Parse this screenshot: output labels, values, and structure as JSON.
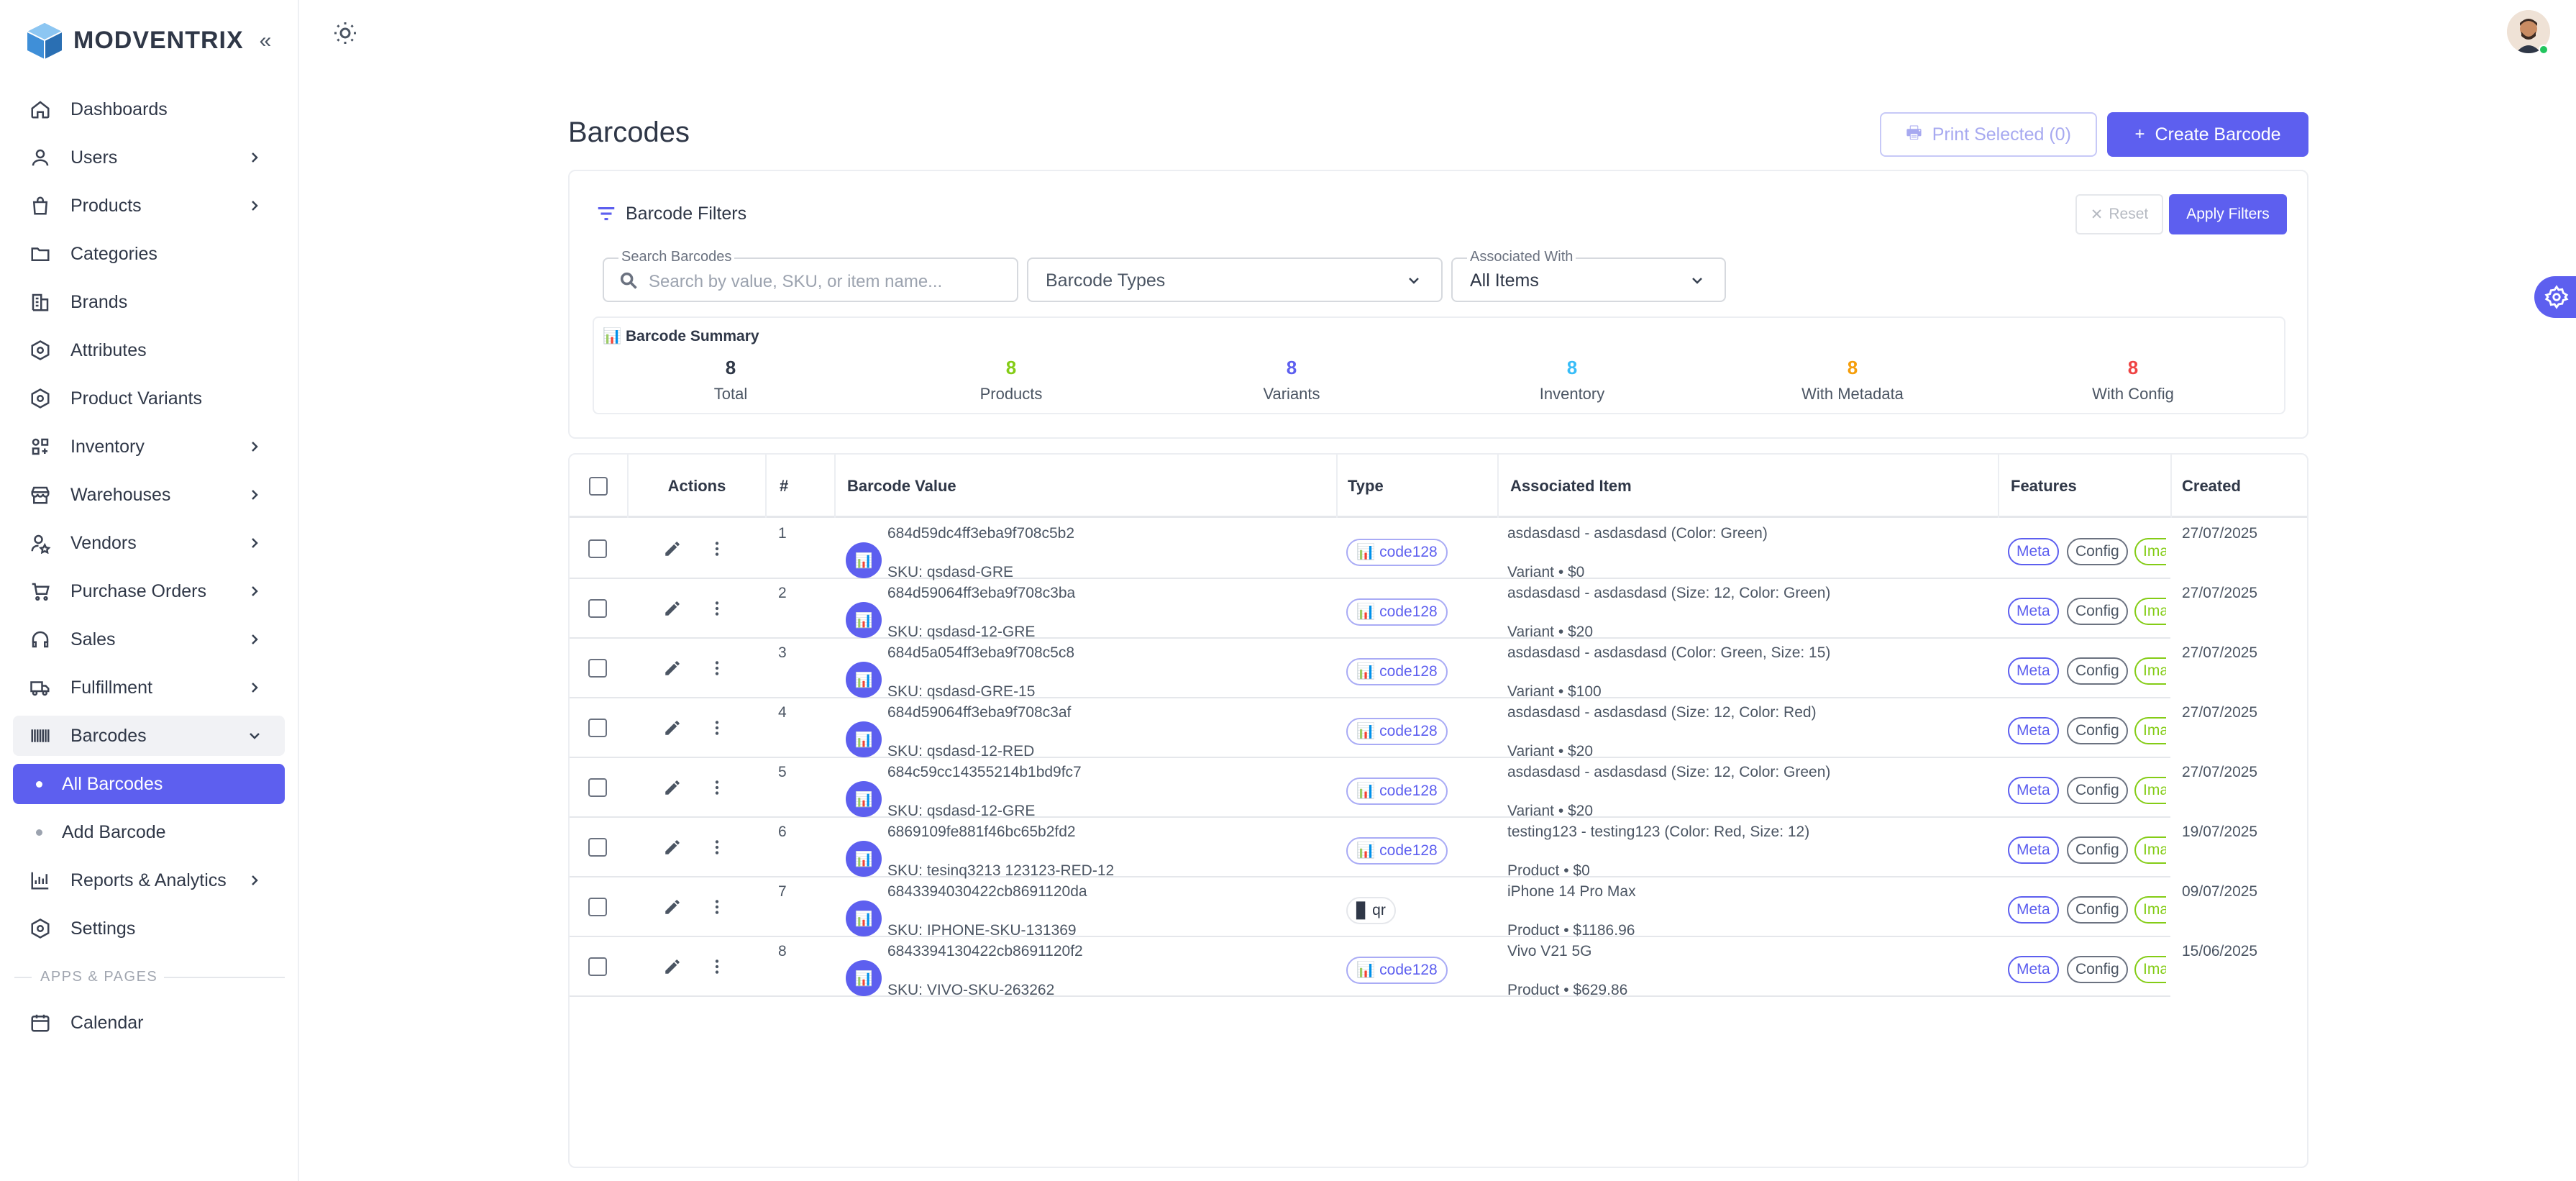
{
  "brand": {
    "name": "MODVENTRIX"
  },
  "sidebar": {
    "items": [
      {
        "label": "Dashboards",
        "icon": "home-icon",
        "chevron": false
      },
      {
        "label": "Users",
        "icon": "user-icon",
        "chevron": true
      },
      {
        "label": "Products",
        "icon": "bag-icon",
        "chevron": true
      },
      {
        "label": "Categories",
        "icon": "folder-icon",
        "chevron": false
      },
      {
        "label": "Brands",
        "icon": "building-icon",
        "chevron": false
      },
      {
        "label": "Attributes",
        "icon": "hexagon-icon",
        "chevron": false
      },
      {
        "label": "Product Variants",
        "icon": "hexagon-icon",
        "chevron": false
      },
      {
        "label": "Inventory",
        "icon": "inventory-icon",
        "chevron": true
      },
      {
        "label": "Warehouses",
        "icon": "store-icon",
        "chevron": true
      },
      {
        "label": "Vendors",
        "icon": "vendor-icon",
        "chevron": true
      },
      {
        "label": "Purchase Orders",
        "icon": "cart-icon",
        "chevron": true
      },
      {
        "label": "Sales",
        "icon": "headset-icon",
        "chevron": true
      },
      {
        "label": "Fulfillment",
        "icon": "truck-icon",
        "chevron": true
      },
      {
        "label": "Barcodes",
        "icon": "barcode-icon",
        "chevron": true
      }
    ],
    "sub_items": [
      {
        "label": "All Barcodes"
      },
      {
        "label": "Add Barcode"
      }
    ],
    "after_items": [
      {
        "label": "Reports & Analytics",
        "icon": "chart-icon",
        "chevron": true
      },
      {
        "label": "Settings",
        "icon": "hexagon-icon",
        "chevron": false
      }
    ],
    "section_label": "APPS & PAGES",
    "apps": [
      {
        "label": "Calendar",
        "icon": "calendar-icon"
      }
    ]
  },
  "page": {
    "title": "Barcodes",
    "print_label": "Print Selected (0)",
    "create_label": "Create Barcode"
  },
  "filters": {
    "title": "Barcode Filters",
    "reset_label": "Reset",
    "apply_label": "Apply Filters",
    "search_label": "Search Barcodes",
    "search_placeholder": "Search by value, SKU, or item name...",
    "types_placeholder": "Barcode Types",
    "assoc_label": "Associated With",
    "assoc_value": "All Items"
  },
  "summary": {
    "title": "📊 Barcode Summary",
    "stats": [
      {
        "value": "8",
        "label": "Total",
        "color": "#2f3747"
      },
      {
        "value": "8",
        "label": "Products",
        "color": "#84cc16"
      },
      {
        "value": "8",
        "label": "Variants",
        "color": "#5d5fef"
      },
      {
        "value": "8",
        "label": "Inventory",
        "color": "#38bdf8"
      },
      {
        "value": "8",
        "label": "With Metadata",
        "color": "#f59e0b"
      },
      {
        "value": "8",
        "label": "With Config",
        "color": "#ef4444"
      }
    ]
  },
  "table": {
    "headers": [
      "Actions",
      "#",
      "Barcode Value",
      "Type",
      "Associated Item",
      "Features",
      "Created"
    ],
    "feature_labels": {
      "meta": "Meta",
      "config": "Config",
      "image": "Image"
    },
    "rows": [
      {
        "num": "1",
        "value": "684d59dc4ff3eba9f708c5b2",
        "sku": "SKU: qsdasd-GRE",
        "type": "code128",
        "type_icon": "📊",
        "item": "asdasdasd - asdasdasd (Color: Green)",
        "item_sub": "Variant • $0",
        "created": "27/07/2025"
      },
      {
        "num": "2",
        "value": "684d59064ff3eba9f708c3ba",
        "sku": "SKU: qsdasd-12-GRE",
        "type": "code128",
        "type_icon": "📊",
        "item": "asdasdasd - asdasdasd (Size: 12, Color: Green)",
        "item_sub": "Variant • $20",
        "created": "27/07/2025"
      },
      {
        "num": "3",
        "value": "684d5a054ff3eba9f708c5c8",
        "sku": "SKU: qsdasd-GRE-15",
        "type": "code128",
        "type_icon": "📊",
        "item": "asdasdasd - asdasdasd (Color: Green, Size: 15)",
        "item_sub": "Variant • $100",
        "created": "27/07/2025"
      },
      {
        "num": "4",
        "value": "684d59064ff3eba9f708c3af",
        "sku": "SKU: qsdasd-12-RED",
        "type": "code128",
        "type_icon": "📊",
        "item": "asdasdasd - asdasdasd (Size: 12, Color: Red)",
        "item_sub": "Variant • $20",
        "created": "27/07/2025"
      },
      {
        "num": "5",
        "value": "684c59cc14355214b1bd9fc7",
        "sku": "SKU: qsdasd-12-GRE",
        "type": "code128",
        "type_icon": "📊",
        "item": "asdasdasd - asdasdasd (Size: 12, Color: Green)",
        "item_sub": "Variant • $20",
        "created": "27/07/2025"
      },
      {
        "num": "6",
        "value": "6869109fe881f46bc65b2fd2",
        "sku": "SKU: tesinq3213 123123-RED-12",
        "type": "code128",
        "type_icon": "📊",
        "item": "testing123 - testing123 (Color: Red, Size: 12)",
        "item_sub": "Product • $0",
        "created": "19/07/2025"
      },
      {
        "num": "7",
        "value": "6843394030422cb8691120da",
        "sku": "SKU: IPHONE-SKU-131369",
        "type": "qr",
        "type_icon": "▊",
        "item": "iPhone 14 Pro Max",
        "item_sub": "Product • $1186.96",
        "created": "09/07/2025"
      },
      {
        "num": "8",
        "value": "6843394130422cb8691120f2",
        "sku": "SKU: VIVO-SKU-263262",
        "type": "code128",
        "type_icon": "📊",
        "item": "Vivo V21 5G",
        "item_sub": "Product • $629.86",
        "created": "15/06/2025"
      }
    ]
  }
}
